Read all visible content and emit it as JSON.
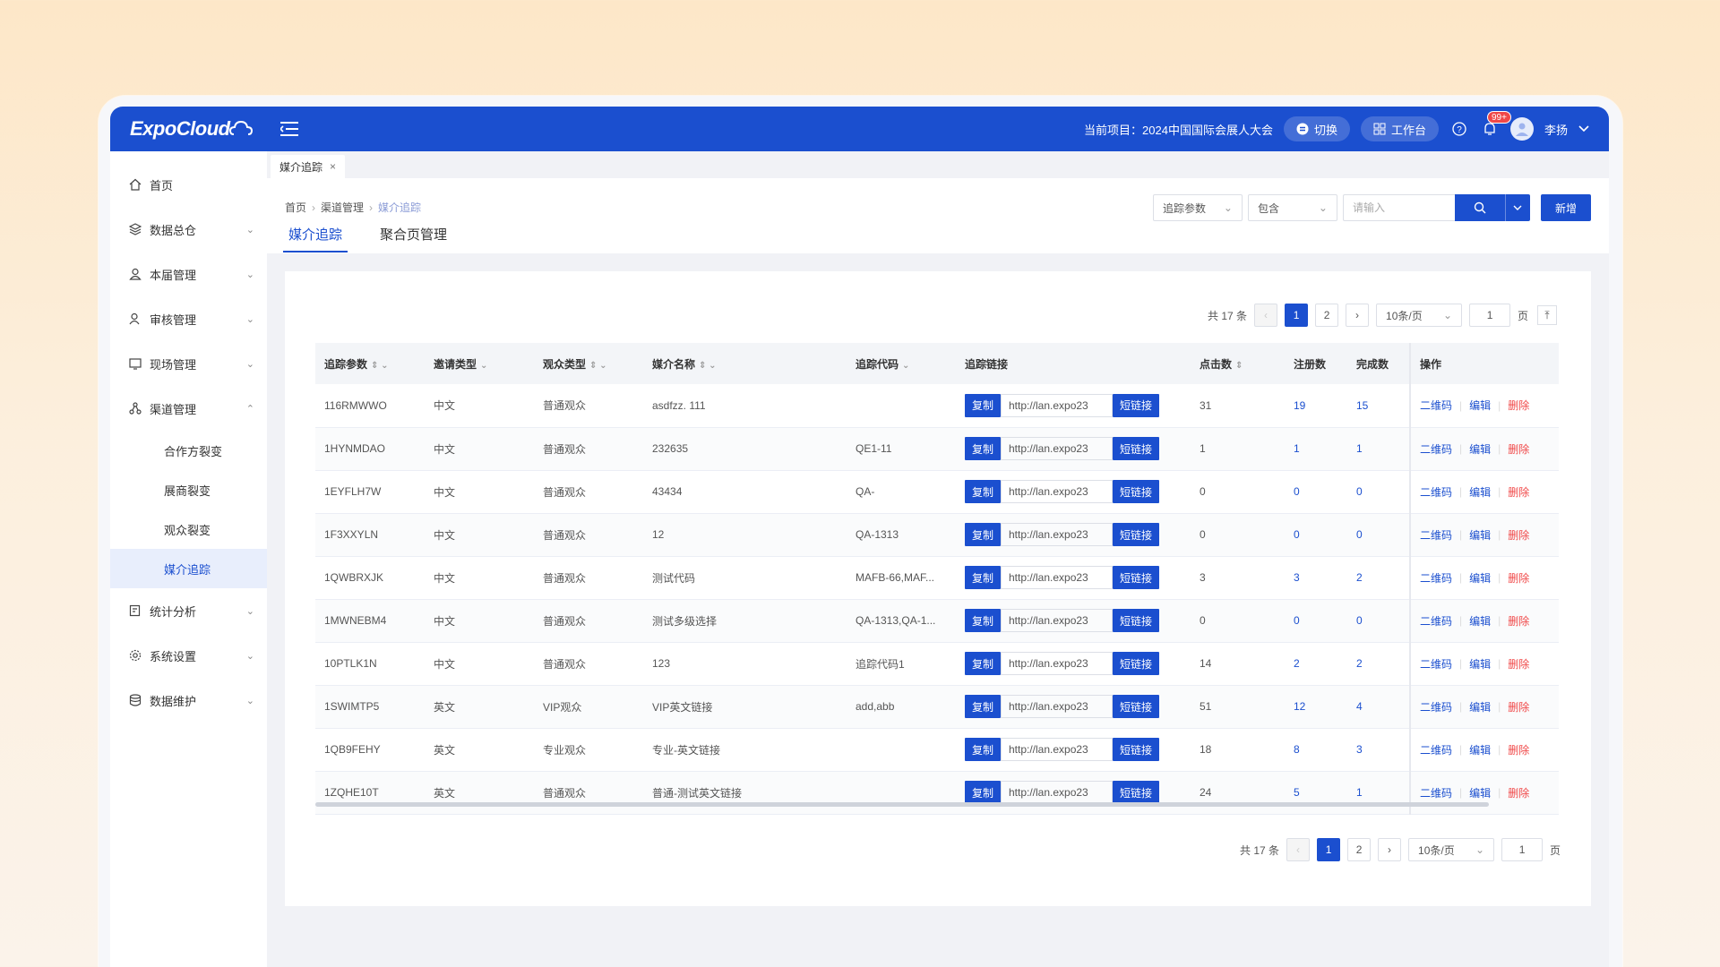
{
  "brand": {
    "logo_text": "ExpoCloud",
    "accent": "#1b4fcf"
  },
  "topbar": {
    "project_label": "当前项目：2024中国国际会展人大会",
    "switch_label": "切换",
    "workbench_label": "工作台",
    "notification_badge": "99+",
    "user_name": "李扬"
  },
  "sidebar": {
    "items": [
      {
        "label": "首页",
        "icon": "home-icon"
      },
      {
        "label": "数据总仓",
        "icon": "layers-icon"
      },
      {
        "label": "本届管理",
        "icon": "user-icon"
      },
      {
        "label": "审核管理",
        "icon": "user-check-icon"
      },
      {
        "label": "现场管理",
        "icon": "monitor-icon"
      },
      {
        "label": "渠道管理",
        "icon": "share-icon"
      },
      {
        "label": "统计分析",
        "icon": "edit-chart-icon"
      },
      {
        "label": "系统设置",
        "icon": "gear-icon"
      },
      {
        "label": "数据维护",
        "icon": "database-icon"
      }
    ],
    "channel_sub": [
      "合作方裂变",
      "展商裂变",
      "观众裂变",
      "媒介追踪"
    ]
  },
  "page_tab": {
    "label": "媒介追踪",
    "close": "×"
  },
  "breadcrumb": [
    "首页",
    "渠道管理",
    "媒介追踪"
  ],
  "subtabs": [
    "媒介追踪",
    "聚合页管理"
  ],
  "filters": {
    "param_select": "追踪参数",
    "op_select": "包含",
    "input_placeholder": "请输入",
    "new_label": "新增"
  },
  "pagination": {
    "total_text": "共 17 条",
    "pages": [
      "1",
      "2"
    ],
    "page_size": "10条/页",
    "jump_value": "1",
    "page_suffix": "页"
  },
  "table": {
    "headers": [
      "追踪参数",
      "邀请类型",
      "观众类型",
      "媒介名称",
      "追踪代码",
      "追踪链接",
      "点击数",
      "注册数",
      "完成数",
      "操作"
    ],
    "copy_label": "复制",
    "short_label": "短链接",
    "ops": [
      "二维码",
      "编辑",
      "删除"
    ],
    "rows": [
      {
        "param": "116RMWWO",
        "invite": "中文",
        "audience": "普通观众",
        "media": "asdfzz. 111",
        "code": "",
        "url": "http://lan.expo23",
        "clicks": "31",
        "reg": "19",
        "done": "15"
      },
      {
        "param": "1HYNMDAO",
        "invite": "中文",
        "audience": "普通观众",
        "media": "232635",
        "code": "QE1-11",
        "url": "http://lan.expo23",
        "clicks": "1",
        "reg": "1",
        "done": "1"
      },
      {
        "param": "1EYFLH7W",
        "invite": "中文",
        "audience": "普通观众",
        "media": "43434",
        "code": "QA-",
        "url": "http://lan.expo23",
        "clicks": "0",
        "reg": "0",
        "done": "0"
      },
      {
        "param": "1F3XXYLN",
        "invite": "中文",
        "audience": "普通观众",
        "media": "12",
        "code": "QA-1313",
        "url": "http://lan.expo23",
        "clicks": "0",
        "reg": "0",
        "done": "0"
      },
      {
        "param": "1QWBRXJK",
        "invite": "中文",
        "audience": "普通观众",
        "media": "测试代码",
        "code": "MAFB-66,MAF...",
        "url": "http://lan.expo23",
        "clicks": "3",
        "reg": "3",
        "done": "2"
      },
      {
        "param": "1MWNEBM4",
        "invite": "中文",
        "audience": "普通观众",
        "media": "测试多级选择",
        "code": "QA-1313,QA-1...",
        "url": "http://lan.expo23",
        "clicks": "0",
        "reg": "0",
        "done": "0"
      },
      {
        "param": "10PTLK1N",
        "invite": "中文",
        "audience": "普通观众",
        "media": "123",
        "code": "追踪代码1",
        "url": "http://lan.expo23",
        "clicks": "14",
        "reg": "2",
        "done": "2"
      },
      {
        "param": "1SWIMTP5",
        "invite": "英文",
        "audience": "VIP观众",
        "media": "VIP英文链接",
        "code": "add,abb",
        "url": "http://lan.expo23",
        "clicks": "51",
        "reg": "12",
        "done": "4"
      },
      {
        "param": "1QB9FEHY",
        "invite": "英文",
        "audience": "专业观众",
        "media": "专业-英文链接",
        "code": "",
        "url": "http://lan.expo23",
        "clicks": "18",
        "reg": "8",
        "done": "3"
      },
      {
        "param": "1ZQHE10T",
        "invite": "英文",
        "audience": "普通观众",
        "media": "普通-测试英文链接",
        "code": "",
        "url": "http://lan.expo23",
        "clicks": "24",
        "reg": "5",
        "done": "1"
      }
    ]
  }
}
